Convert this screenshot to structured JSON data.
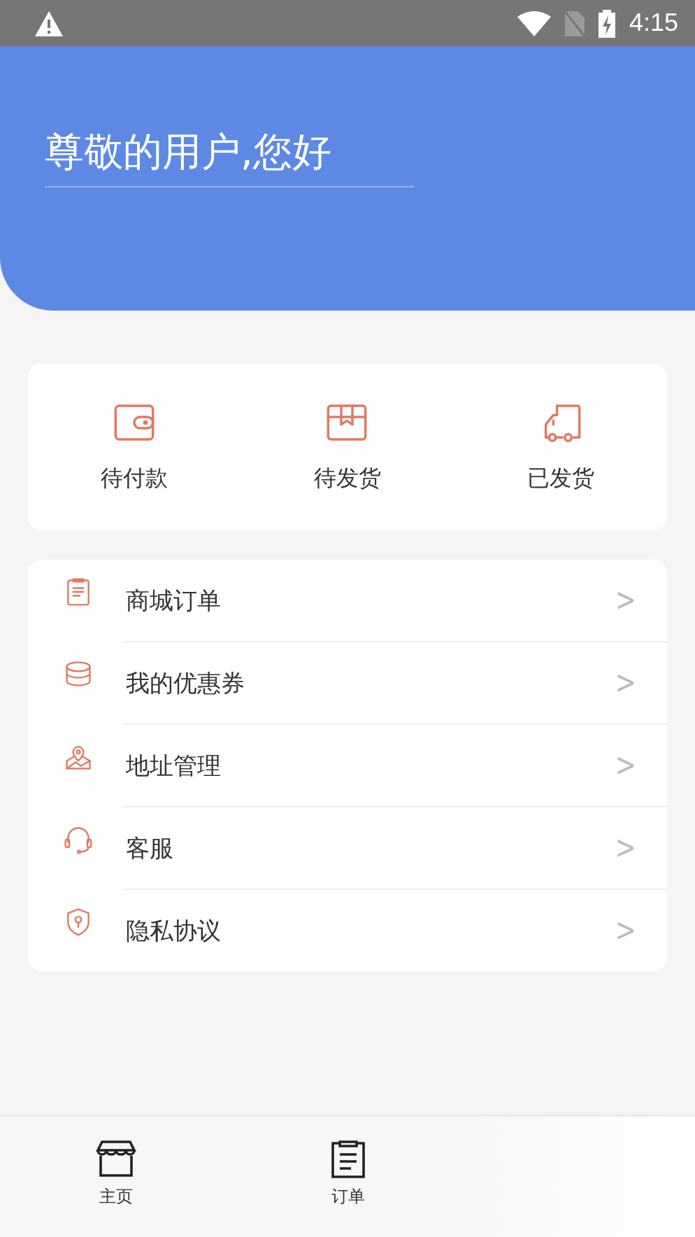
{
  "status_bar": {
    "time": "4:15"
  },
  "header": {
    "greeting": "尊敬的用户,您好"
  },
  "order_status": [
    {
      "label": "待付款"
    },
    {
      "label": "待发货"
    },
    {
      "label": "已发货"
    }
  ],
  "menu": [
    {
      "label": "商城订单",
      "chevron": ">"
    },
    {
      "label": "我的优惠券",
      "chevron": ">"
    },
    {
      "label": "地址管理",
      "chevron": ">"
    },
    {
      "label": "客服",
      "chevron": ">"
    },
    {
      "label": "隐私协议",
      "chevron": ">"
    }
  ],
  "bottom_nav": [
    {
      "label": "主页"
    },
    {
      "label": "订单"
    }
  ]
}
